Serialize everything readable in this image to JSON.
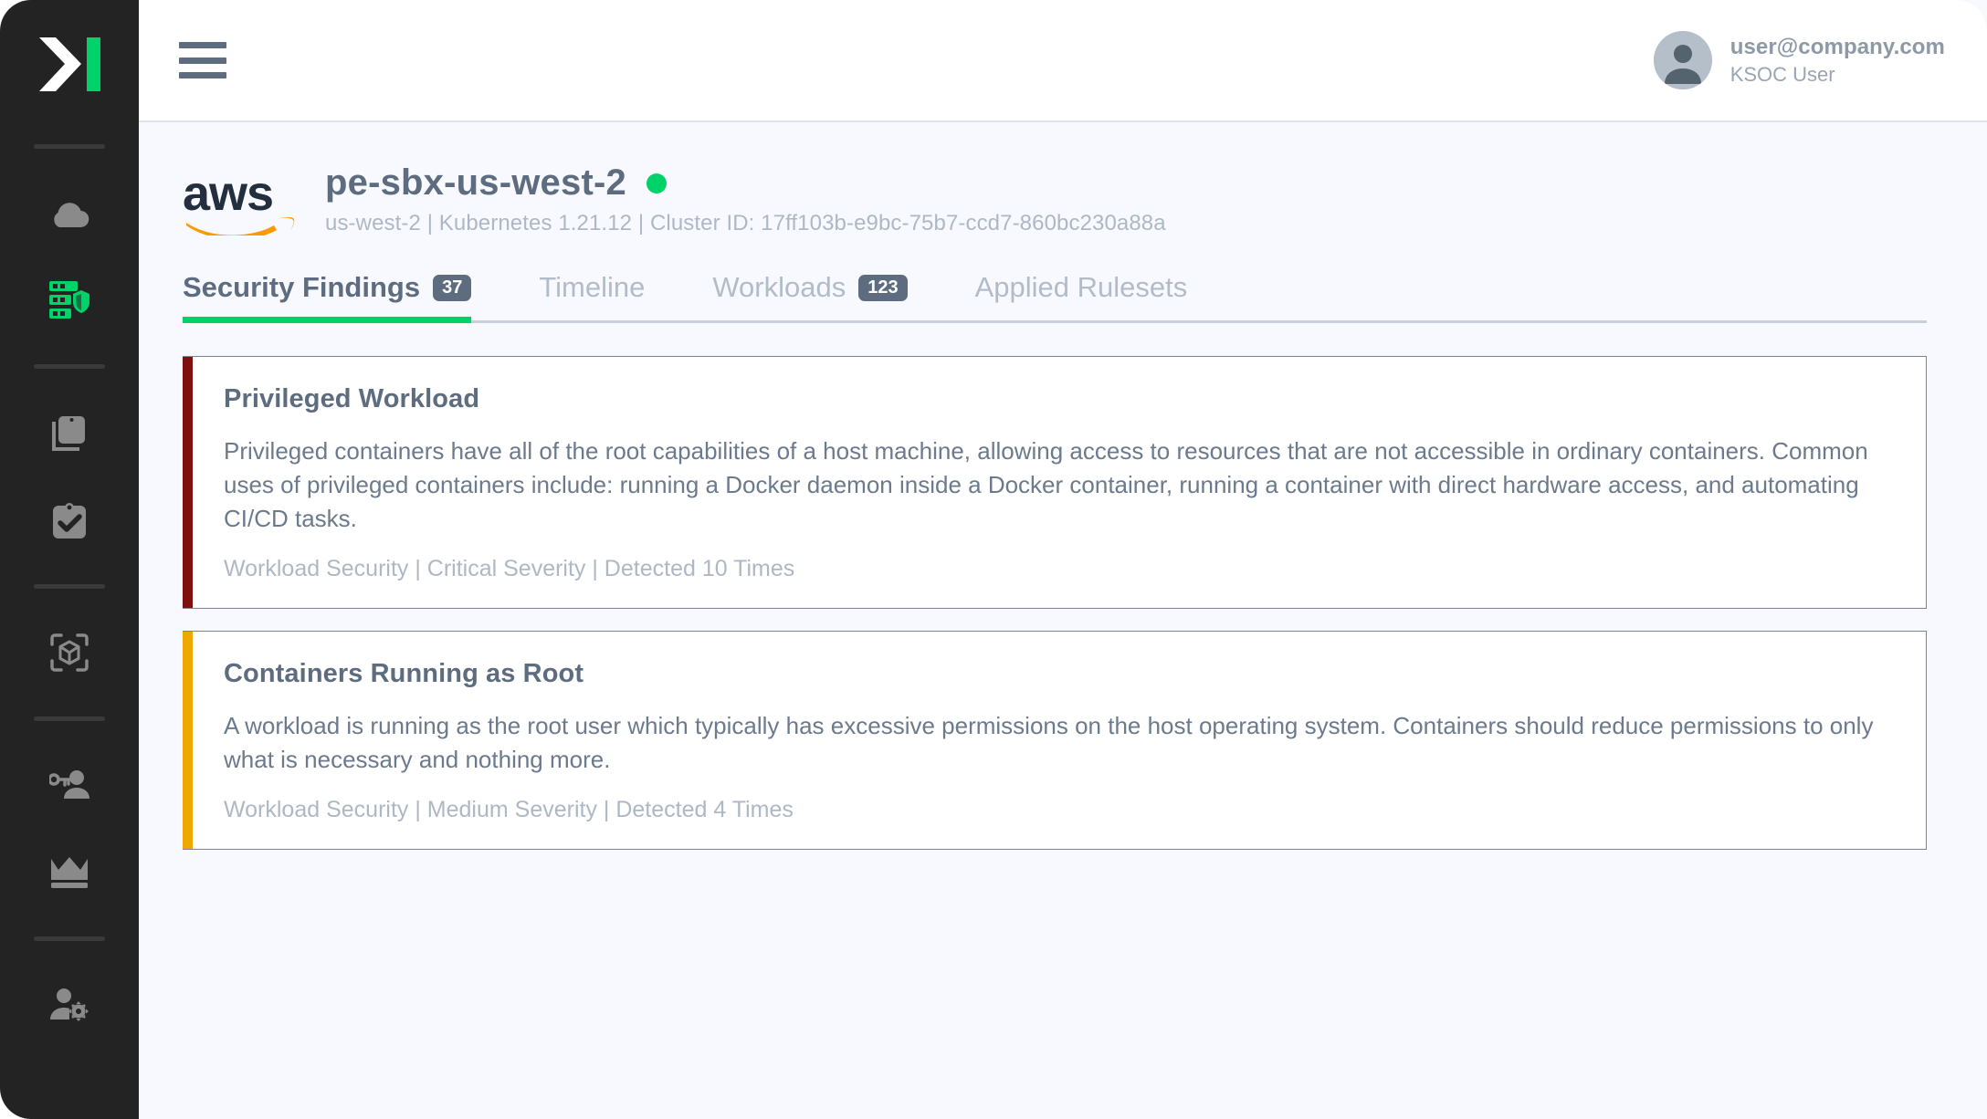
{
  "sidebar": {
    "logo_name": "ksoc-logo",
    "items": [
      {
        "name": "cloud-icon",
        "icon": "cloud",
        "active": false
      },
      {
        "name": "server-shield-icon",
        "icon": "server-shield",
        "active": true
      },
      {
        "name": "clipboard-stack-icon",
        "icon": "clipboard-stack",
        "active": false
      },
      {
        "name": "clipboard-check-icon",
        "icon": "clipboard-check",
        "active": false
      },
      {
        "name": "cube-scan-icon",
        "icon": "cube-scan",
        "active": false
      },
      {
        "name": "key-user-icon",
        "icon": "key-user",
        "active": false
      },
      {
        "name": "crown-icon",
        "icon": "crown",
        "active": false
      },
      {
        "name": "user-settings-icon",
        "icon": "user-settings",
        "active": false
      }
    ]
  },
  "topbar": {
    "menu_icon": "hamburger-icon",
    "user": {
      "avatar_icon": "person-avatar-icon",
      "email": "user@company.com",
      "role": "KSOC User"
    }
  },
  "cluster": {
    "provider_logo": "aws-logo",
    "name": "pe-sbx-us-west-2",
    "status": "healthy",
    "status_color": "#00D26A",
    "subtitle": "us-west-2 | Kubernetes 1.21.12 | Cluster ID: 17ff103b-e9bc-75b7-ccd7-860bc230a88a",
    "region": "us-west-2",
    "kubernetes_version": "1.21.12",
    "cluster_id": "17ff103b-e9bc-75b7-ccd7-860bc230a88a"
  },
  "tabs": [
    {
      "label": "Security Findings",
      "badge": "37",
      "active": true
    },
    {
      "label": "Timeline",
      "badge": null,
      "active": false
    },
    {
      "label": "Workloads",
      "badge": "123",
      "active": false
    },
    {
      "label": "Applied Rulesets",
      "badge": null,
      "active": false
    }
  ],
  "findings": [
    {
      "title": "Privileged Workload",
      "description": "Privileged containers have all of the root capabilities of a host machine, allowing access to resources that are not accessible in ordinary containers. Common uses of privileged containers include: running a Docker daemon inside a Docker container, running a container with direct hardware access, and automating CI/CD tasks.",
      "footer": "Workload Security | Critical Severity | Detected 10 Times",
      "category": "Workload Security",
      "severity": "Critical Severity",
      "detected": "Detected 10 Times",
      "severity_color": "#7F1010"
    },
    {
      "title": "Containers Running as Root",
      "description": "A workload is running as the root user which typically has excessive permissions on the host operating system. Containers should reduce permissions to only what is necessary and nothing more.",
      "footer": "Workload Security | Medium Severity | Detected 4 Times",
      "category": "Workload Security",
      "severity": "Medium Severity",
      "detected": "Detected 4 Times",
      "severity_color": "#EDA900"
    }
  ],
  "theme": {
    "accent_green": "#00D26A",
    "sidebar_bg": "#232323",
    "page_bg": "#F8F9FE",
    "text_slate": "#5D6C7E",
    "aws_navy": "#232F3E",
    "aws_orange": "#FF9900"
  }
}
